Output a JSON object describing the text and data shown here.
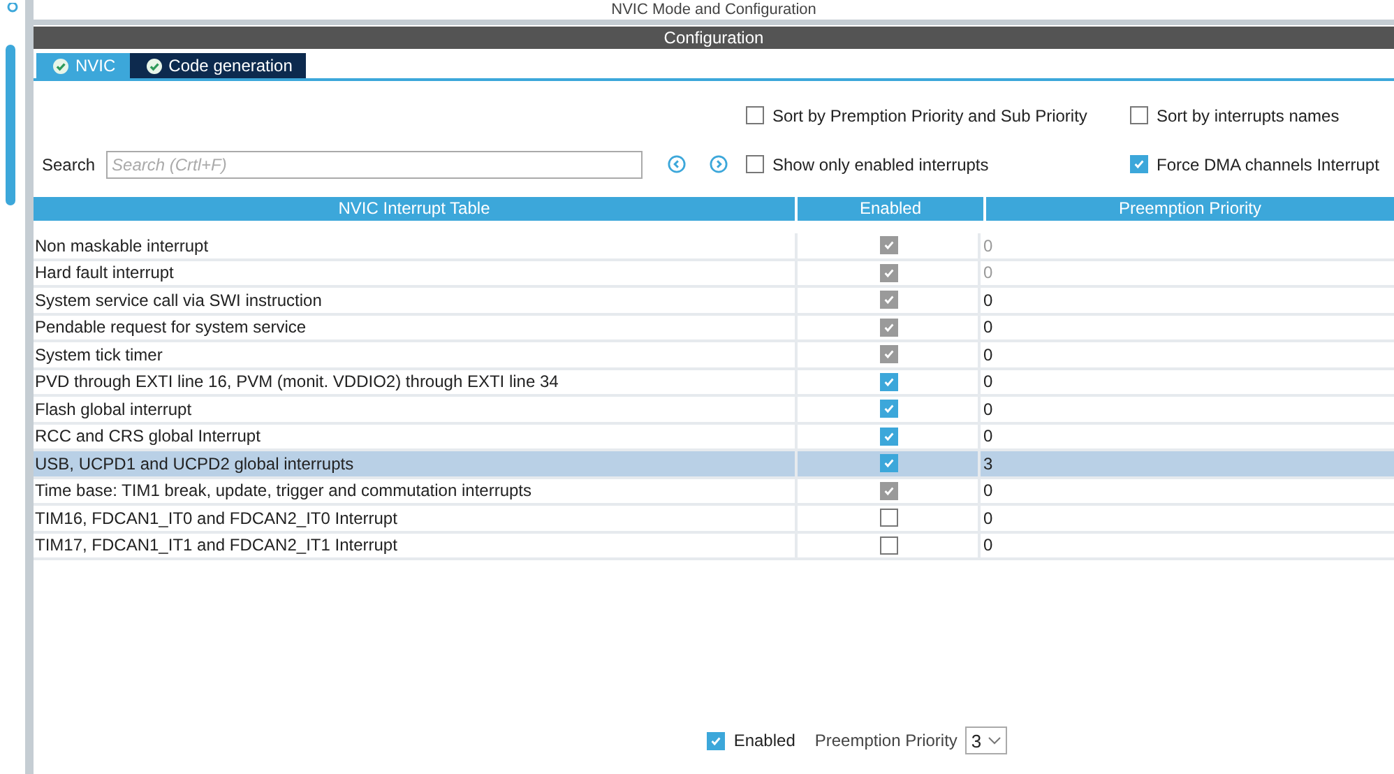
{
  "window": {
    "title": "NVIC Mode and Configuration"
  },
  "section_title": "Configuration",
  "tabs": [
    {
      "label": "NVIC",
      "selected": true
    },
    {
      "label": "Code generation",
      "selected": false
    }
  ],
  "search": {
    "label": "Search",
    "placeholder": "Search (Crtl+F)"
  },
  "options": [
    {
      "label": "Sort by Premption Priority and Sub Priority",
      "checked": false
    },
    {
      "label": "Sort by interrupts names",
      "checked": false
    },
    {
      "label": "Show only enabled interrupts",
      "checked": false
    },
    {
      "label": "Force DMA channels Interrupt",
      "checked": true
    }
  ],
  "table": {
    "columns": [
      "NVIC Interrupt Table",
      "Enabled",
      "Preemption Priority"
    ],
    "rows": [
      {
        "name": "Non maskable interrupt",
        "enabled": true,
        "disabled": true,
        "priority": "0",
        "priority_disabled": true,
        "selected": false
      },
      {
        "name": "Hard fault interrupt",
        "enabled": true,
        "disabled": true,
        "priority": "0",
        "priority_disabled": true,
        "selected": false
      },
      {
        "name": "System service call via SWI instruction",
        "enabled": true,
        "disabled": true,
        "priority": "0",
        "priority_disabled": false,
        "selected": false
      },
      {
        "name": "Pendable request for system service",
        "enabled": true,
        "disabled": true,
        "priority": "0",
        "priority_disabled": false,
        "selected": false
      },
      {
        "name": "System tick timer",
        "enabled": true,
        "disabled": true,
        "priority": "0",
        "priority_disabled": false,
        "selected": false
      },
      {
        "name": "PVD through EXTI line 16, PVM (monit. VDDIO2) through EXTI line 34",
        "enabled": true,
        "disabled": false,
        "priority": "0",
        "priority_disabled": false,
        "selected": false
      },
      {
        "name": "Flash global interrupt",
        "enabled": true,
        "disabled": false,
        "priority": "0",
        "priority_disabled": false,
        "selected": false
      },
      {
        "name": "RCC and CRS global Interrupt",
        "enabled": true,
        "disabled": false,
        "priority": "0",
        "priority_disabled": false,
        "selected": false
      },
      {
        "name": "USB, UCPD1 and UCPD2 global interrupts",
        "enabled": true,
        "disabled": false,
        "priority": "3",
        "priority_disabled": false,
        "selected": true
      },
      {
        "name": "Time base: TIM1 break, update, trigger and commutation interrupts",
        "enabled": true,
        "disabled": true,
        "priority": "0",
        "priority_disabled": false,
        "selected": false
      },
      {
        "name": "TIM16, FDCAN1_IT0 and FDCAN2_IT0 Interrupt",
        "enabled": false,
        "disabled": false,
        "priority": "0",
        "priority_disabled": false,
        "selected": false
      },
      {
        "name": "TIM17, FDCAN1_IT1 and FDCAN2_IT1 Interrupt",
        "enabled": false,
        "disabled": false,
        "priority": "0",
        "priority_disabled": false,
        "selected": false
      }
    ]
  },
  "footer": {
    "enabled": {
      "label": "Enabled",
      "checked": true
    },
    "priority_label": "Preemption Priority",
    "priority_value": "3"
  }
}
